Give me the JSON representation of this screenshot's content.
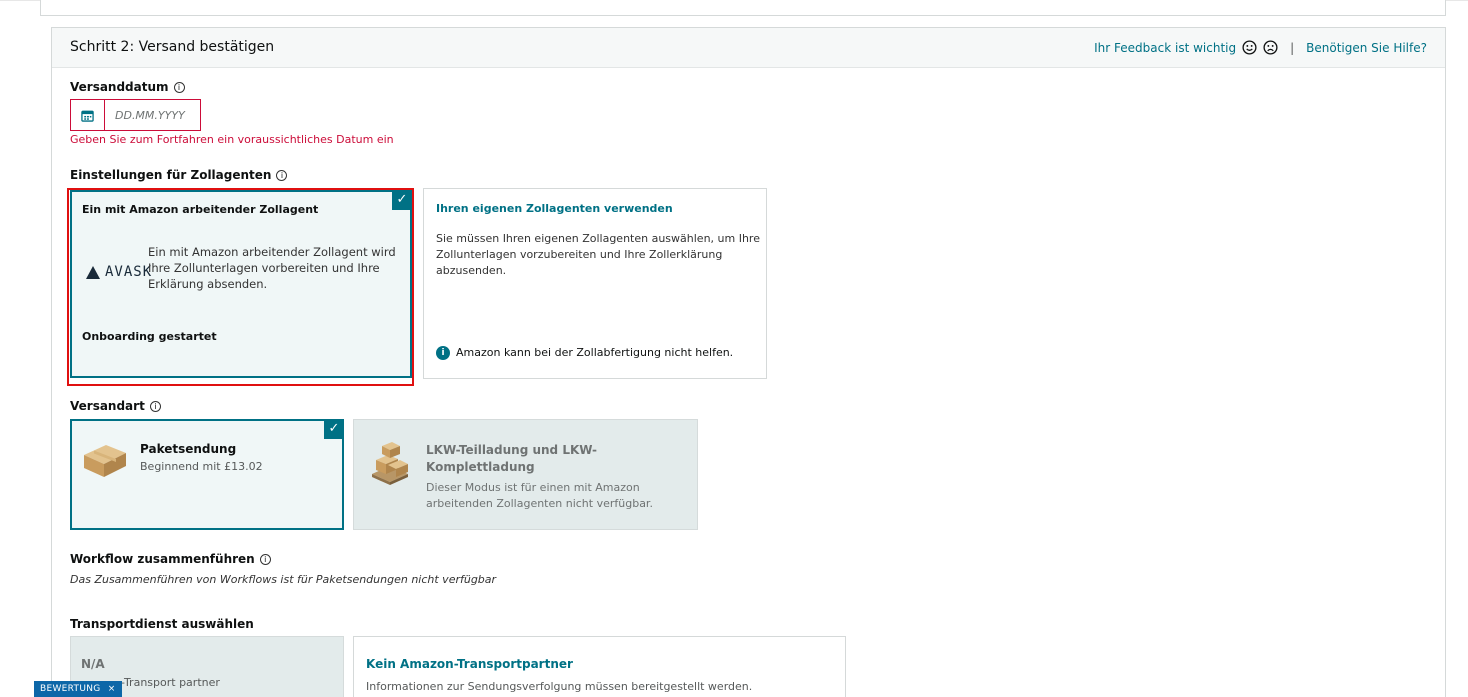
{
  "header": {
    "title": "Schritt 2: Versand bestätigen",
    "feedback_label": "Ihr Feedback ist wichtig",
    "separator": "|",
    "help_label": "Benötigen Sie Hilfe?"
  },
  "ship_date": {
    "label": "Versanddatum",
    "placeholder": "DD.MM.YYYY",
    "error": "Geben Sie zum Fortfahren ein voraussichtliches Datum ein"
  },
  "customs": {
    "label": "Einstellungen für Zollagenten",
    "options": [
      {
        "title": "Ein mit Amazon arbeitender Zollagent",
        "logo_text": "AVASK",
        "description": "Ein mit Amazon arbeitender Zollagent wird Ihre Zollunterlagen vorbereiten und Ihre Erklärung absenden.",
        "status": "Onboarding gestartet",
        "selected": true
      },
      {
        "title": "Ihren eigenen Zollagenten verwenden",
        "description": "Sie müssen Ihren eigenen Zollagenten auswählen, um Ihre Zollunterlagen vorzubereiten und Ihre Zollerklärung abzusenden.",
        "note": "Amazon kann bei der Zollabfertigung nicht helfen.",
        "selected": false
      }
    ]
  },
  "shipping_mode": {
    "label": "Versandart",
    "options": [
      {
        "title": "Paketsendung",
        "subtitle": "Beginnend mit £13.02",
        "selected": true,
        "disabled": false
      },
      {
        "title": "LKW-Teilladung und LKW-Komplettladung",
        "subtitle": "Dieser Modus ist für einen mit Amazon arbeitenden Zollagenten nicht verfügbar.",
        "selected": false,
        "disabled": true
      }
    ]
  },
  "workflow": {
    "label": "Workflow zusammenführen",
    "note": "Das Zusammenführen von Workflows ist für Paketsendungen nicht verfügbar"
  },
  "transport": {
    "label": "Transportdienst auswählen",
    "options": [
      {
        "title": "N/A",
        "subtitle": "-Transport partner",
        "disabled": true
      },
      {
        "title": "Kein Amazon-Transportpartner",
        "subtitle": "Informationen zur Sendungsverfolgung müssen bereitgestellt werden.",
        "disabled": false
      }
    ]
  },
  "feedback_tab": {
    "label": "BEWERTUNG",
    "close": "×"
  },
  "icons": [
    "info-icon",
    "calendar-icon",
    "checkmark-icon",
    "smiley-icon",
    "frown-icon",
    "box-icon",
    "pallet-icon"
  ],
  "colors": {
    "accent": "#007185",
    "error": "#cc0c39",
    "highlight": "#e01010",
    "feedback_tab": "#0d67a8"
  }
}
